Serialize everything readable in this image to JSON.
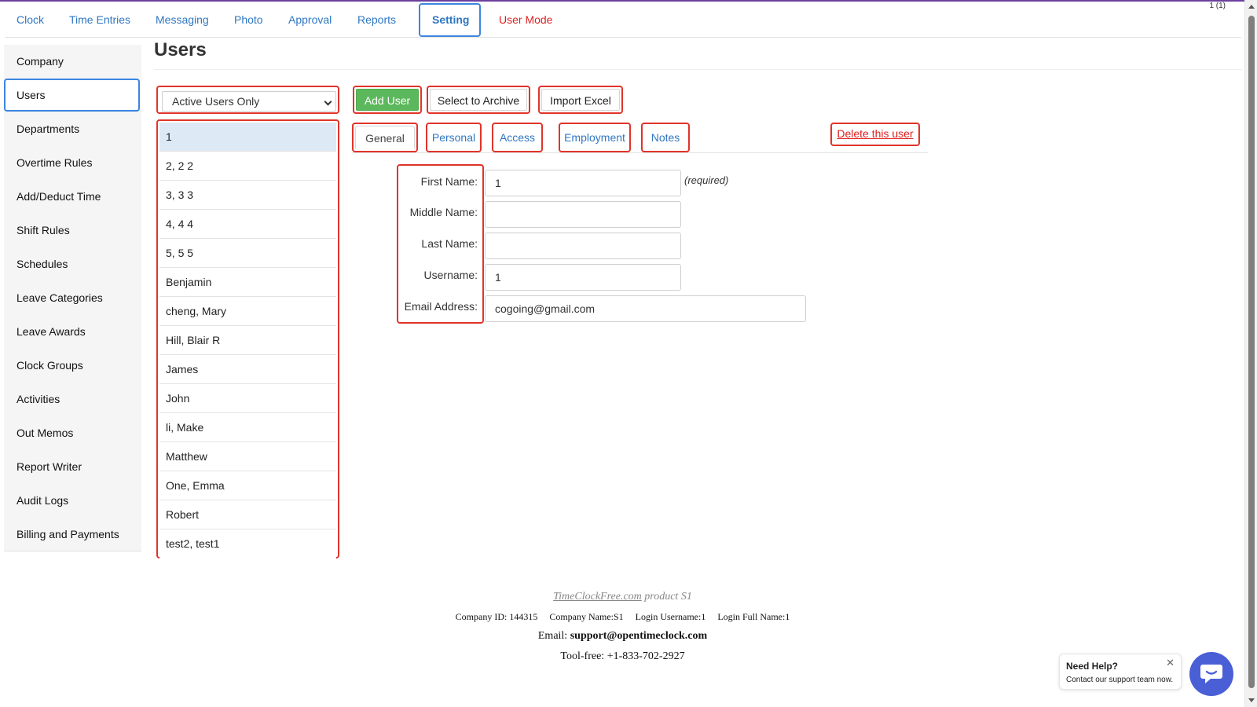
{
  "page_counter": "1 (1)",
  "topnav": {
    "tabs": [
      {
        "label": "Clock"
      },
      {
        "label": "Time Entries"
      },
      {
        "label": "Messaging"
      },
      {
        "label": "Photo"
      },
      {
        "label": "Approval"
      },
      {
        "label": "Reports"
      },
      {
        "label": "Setting"
      },
      {
        "label": "User Mode"
      }
    ],
    "active": "Setting"
  },
  "sidebar": {
    "items": [
      {
        "label": "Company"
      },
      {
        "label": "Users"
      },
      {
        "label": "Departments"
      },
      {
        "label": "Overtime Rules"
      },
      {
        "label": "Add/Deduct Time"
      },
      {
        "label": "Shift Rules"
      },
      {
        "label": "Schedules"
      },
      {
        "label": "Leave Categories"
      },
      {
        "label": "Leave Awards"
      },
      {
        "label": "Clock Groups"
      },
      {
        "label": "Activities"
      },
      {
        "label": "Out Memos"
      },
      {
        "label": "Report Writer"
      },
      {
        "label": "Audit Logs"
      },
      {
        "label": "Billing and Payments"
      }
    ],
    "active": "Users"
  },
  "main": {
    "title": "Users",
    "filter": {
      "selected": "Active Users Only"
    },
    "buttons": {
      "add_user": "Add User",
      "select_to_archive": "Select to Archive",
      "import_excel": "Import Excel"
    },
    "users": [
      {
        "name": "1"
      },
      {
        "name": "2, 2 2"
      },
      {
        "name": "3, 3 3"
      },
      {
        "name": "4, 4 4"
      },
      {
        "name": "5, 5 5"
      },
      {
        "name": "Benjamin"
      },
      {
        "name": "cheng, Mary"
      },
      {
        "name": "Hill, Blair R"
      },
      {
        "name": "James"
      },
      {
        "name": "John"
      },
      {
        "name": "li, Make"
      },
      {
        "name": "Matthew"
      },
      {
        "name": "One, Emma"
      },
      {
        "name": "Robert"
      },
      {
        "name": "test2, test1"
      }
    ],
    "selected_user": "1",
    "tabs": [
      {
        "label": "General"
      },
      {
        "label": "Personal"
      },
      {
        "label": "Access"
      },
      {
        "label": "Employment"
      },
      {
        "label": "Notes"
      }
    ],
    "active_tab": "General",
    "delete_link": "Delete this user",
    "form": {
      "first_name": {
        "label": "First Name:",
        "value": "1"
      },
      "middle_name": {
        "label": "Middle Name:",
        "value": ""
      },
      "last_name": {
        "label": "Last Name:",
        "value": ""
      },
      "username": {
        "label": "Username:",
        "value": "1"
      },
      "email": {
        "label": "Email Address:",
        "value": "cogoing@gmail.com"
      },
      "required_note": "(required)"
    }
  },
  "footer": {
    "brand_link": "TimeClockFree.com",
    "brand_suffix": "product S1",
    "company_id": "Company ID: 144315",
    "company_name": "Company Name:S1",
    "login_username": "Login Username:1",
    "login_full_name": "Login Full Name:1",
    "email_label": "Email:",
    "email_value": "support@opentimeclock.com",
    "phone": "Tool-free: +1-833-702-2927"
  },
  "help": {
    "title": "Need Help?",
    "subtitle": "Contact our support team now.",
    "close": "✕"
  },
  "colors": {
    "accent_blue": "#3b86e0",
    "link_blue": "#2f77c2",
    "highlight_red": "#e0342a",
    "add_green": "#5cb85c",
    "chat_purple": "#4a5fd6"
  },
  "icons": {
    "filter_dropdown": "chevron-down-icon",
    "chat": "chat-icon",
    "help_close": "close-icon"
  }
}
